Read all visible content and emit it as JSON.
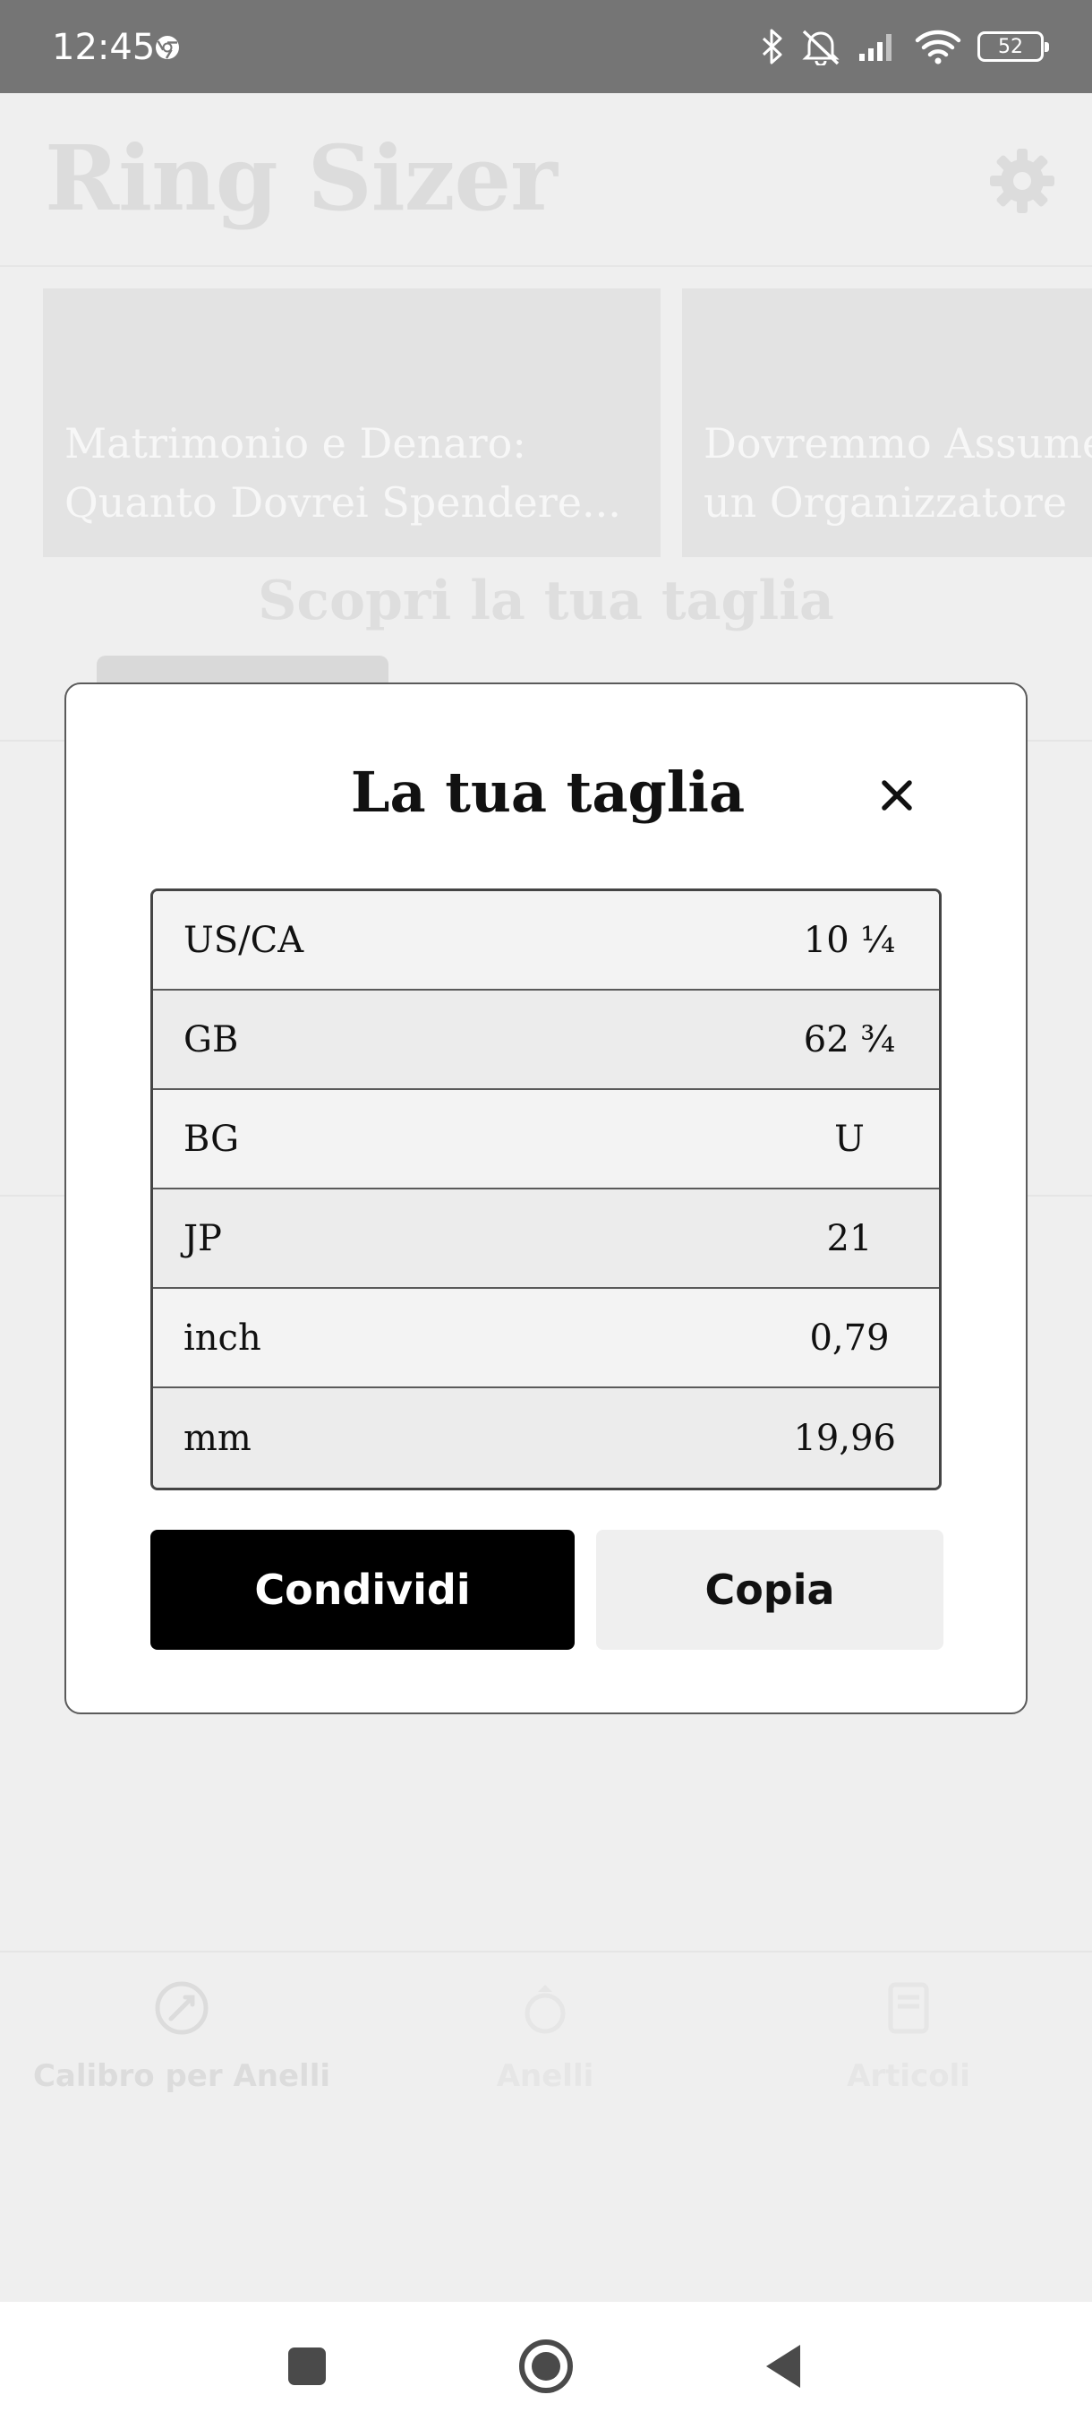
{
  "status_bar": {
    "time": "12:45",
    "battery": "52",
    "icons": [
      "chrome-icon",
      "bluetooth-icon",
      "mute-icon",
      "signal-icon",
      "wifi-icon",
      "battery-icon"
    ]
  },
  "app": {
    "title": "Ring Sizer",
    "cards": [
      {
        "line1": "Matrimonio e Denaro:",
        "line2": "Quanto Dovrei Spendere..."
      },
      {
        "line1": "Dovremmo Assumere",
        "line2": "un Organizzatore"
      }
    ],
    "discover_title": "Scopri la tua taglia"
  },
  "bottom_nav": {
    "items": [
      {
        "label": "Calibro per Anelli",
        "icon": "ruler-circle-icon"
      },
      {
        "label": "Anelli",
        "icon": "ring-icon"
      },
      {
        "label": "Articoli",
        "icon": "article-icon"
      }
    ]
  },
  "modal": {
    "title": "La tua taglia",
    "rows": [
      {
        "label": "US/CA",
        "value": "10 ¼"
      },
      {
        "label": "GB",
        "value": "62 ¾"
      },
      {
        "label": "BG",
        "value": "U"
      },
      {
        "label": "JP",
        "value": "21"
      },
      {
        "label": "inch",
        "value": "0,79"
      },
      {
        "label": "mm",
        "value": "19,96"
      }
    ],
    "share_label": "Condividi",
    "copy_label": "Copia"
  },
  "colors": {
    "status_bar": "#757575",
    "overlay_bg": "#efefef",
    "primary_button": "#000000",
    "secondary_button": "#efefef"
  }
}
